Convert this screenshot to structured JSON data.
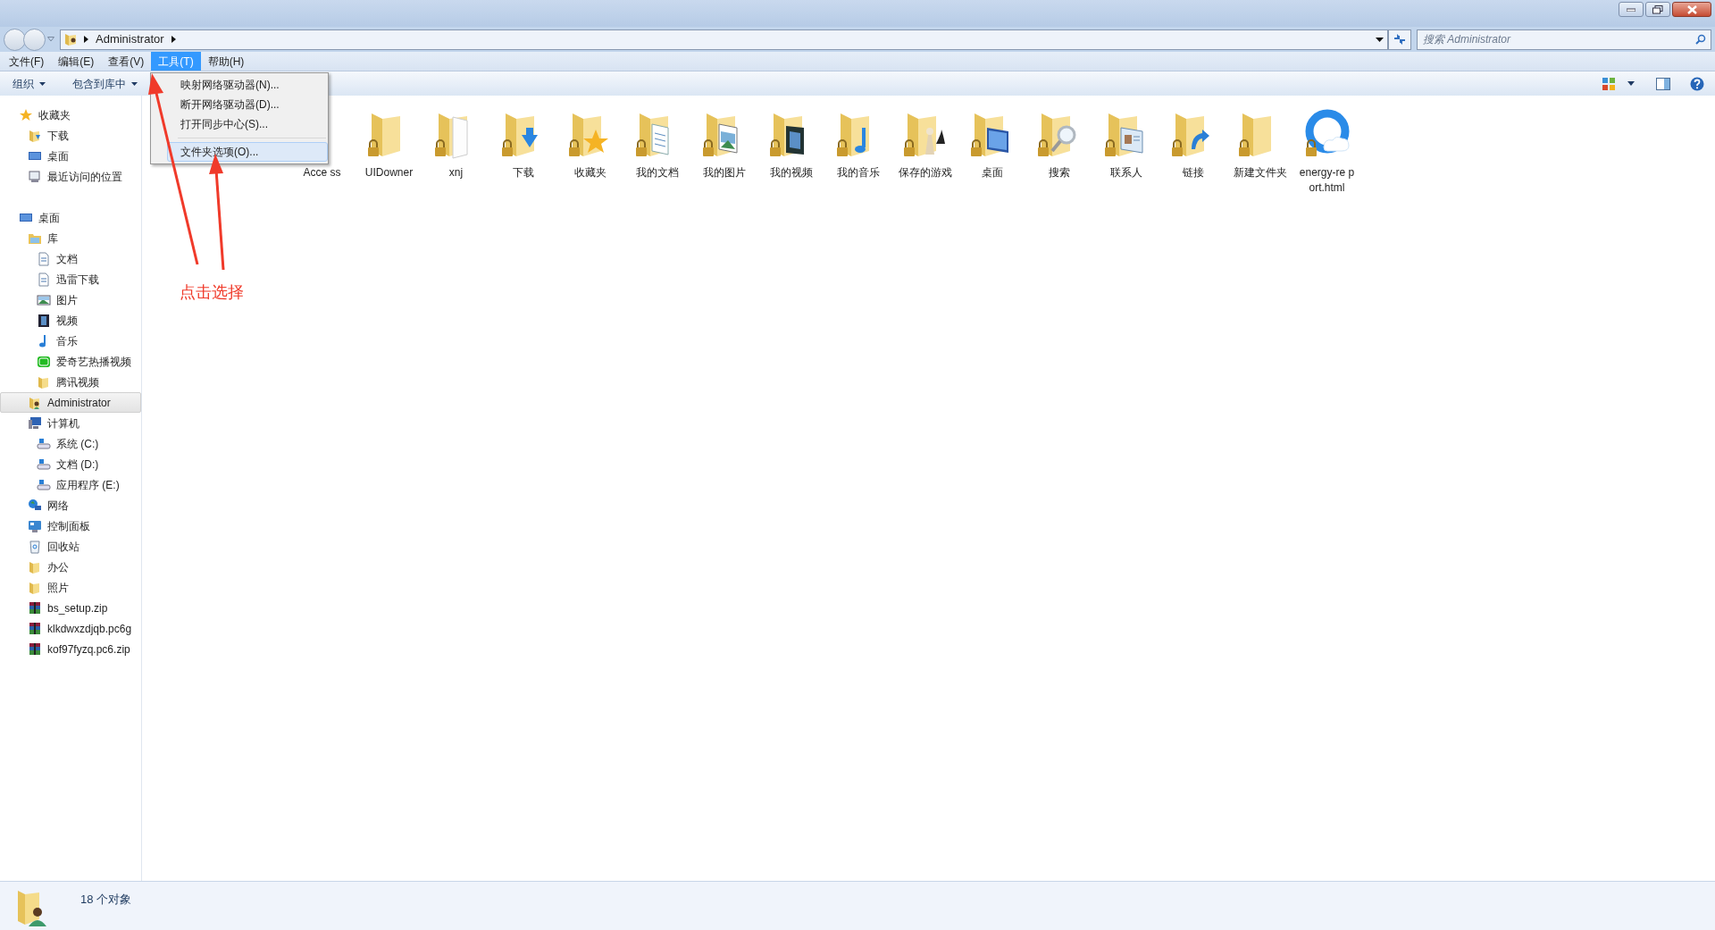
{
  "address_bar": {
    "path": [
      "Administrator"
    ]
  },
  "search": {
    "placeholder": "搜索 Administrator"
  },
  "menu_bar": [
    {
      "label": "文件(F)",
      "selected": false
    },
    {
      "label": "编辑(E)",
      "selected": false
    },
    {
      "label": "查看(V)",
      "selected": false
    },
    {
      "label": "工具(T)",
      "selected": true
    },
    {
      "label": "帮助(H)",
      "selected": false
    }
  ],
  "tools_menu": [
    {
      "label": "映射网络驱动器(N)...",
      "selected": false
    },
    {
      "label": "断开网络驱动器(D)...",
      "selected": false
    },
    {
      "label": "打开同步中心(S)...",
      "selected": false
    },
    {
      "label": "文件夹选项(O)...",
      "selected": true
    }
  ],
  "toolbar": [
    "组织",
    "包含到库中"
  ],
  "sidebar": [
    {
      "label": "收藏夹",
      "kind": "star",
      "selected": false,
      "children": [
        {
          "label": "下载",
          "kind": "download",
          "selected": false
        },
        {
          "label": "桌面",
          "kind": "desktop",
          "selected": false
        },
        {
          "label": "最近访问的位置",
          "kind": "recent",
          "selected": false
        }
      ]
    },
    {
      "label": "桌面",
      "kind": "desktop",
      "selected": false,
      "children": [
        {
          "label": "库",
          "kind": "library",
          "selected": false,
          "children": [
            {
              "label": "文档",
              "kind": "doc",
              "selected": false
            },
            {
              "label": "迅雷下载",
              "kind": "doc",
              "selected": false
            },
            {
              "label": "图片",
              "kind": "picture",
              "selected": false
            },
            {
              "label": "视频",
              "kind": "video",
              "selected": false
            },
            {
              "label": "音乐",
              "kind": "music",
              "selected": false
            },
            {
              "label": "爱奇艺热播视频",
              "kind": "green",
              "selected": false
            },
            {
              "label": "腾讯视频",
              "kind": "folder",
              "selected": false
            }
          ]
        },
        {
          "label": "Administrator",
          "kind": "user",
          "selected": true
        },
        {
          "label": "计算机",
          "kind": "computer",
          "selected": false,
          "children": [
            {
              "label": "系统 (C:)",
              "kind": "drive",
              "selected": false
            },
            {
              "label": "文档 (D:)",
              "kind": "drive",
              "selected": false
            },
            {
              "label": "应用程序 (E:)",
              "kind": "drive",
              "selected": false
            }
          ]
        },
        {
          "label": "网络",
          "kind": "network",
          "selected": false
        },
        {
          "label": "控制面板",
          "kind": "panel",
          "selected": false
        },
        {
          "label": "回收站",
          "kind": "bin",
          "selected": false
        },
        {
          "label": "办公",
          "kind": "folder",
          "selected": false
        },
        {
          "label": "照片",
          "kind": "folder",
          "selected": false
        },
        {
          "label": "bs_setup.zip",
          "kind": "zip",
          "selected": false
        },
        {
          "label": "klkdwxzdjqb.pc6g",
          "kind": "zip",
          "selected": false
        },
        {
          "label": "kof97fyzq.pc6.zip",
          "kind": "zip",
          "selected": false
        }
      ]
    }
  ],
  "files": [
    {
      "label": "Acce ss",
      "kind": "covered"
    },
    {
      "label": "UIDowner",
      "kind": "folder"
    },
    {
      "label": "xnj",
      "kind": "blank"
    },
    {
      "label": "下载",
      "kind": "download"
    },
    {
      "label": "收藏夹",
      "kind": "star"
    },
    {
      "label": "我的文档",
      "kind": "doc"
    },
    {
      "label": "我的图片",
      "kind": "picture"
    },
    {
      "label": "我的视频",
      "kind": "video"
    },
    {
      "label": "我的音乐",
      "kind": "music"
    },
    {
      "label": "保存的游戏",
      "kind": "games"
    },
    {
      "label": "桌面",
      "kind": "desktop"
    },
    {
      "label": "搜索",
      "kind": "search"
    },
    {
      "label": "联系人",
      "kind": "contacts"
    },
    {
      "label": "链接",
      "kind": "links"
    },
    {
      "label": "新建文件夹",
      "kind": "folder"
    },
    {
      "label": "energy-re port.html",
      "kind": "html"
    }
  ],
  "annotation": {
    "text": "点击选择"
  },
  "status_bar": {
    "text": "18 个对象"
  }
}
